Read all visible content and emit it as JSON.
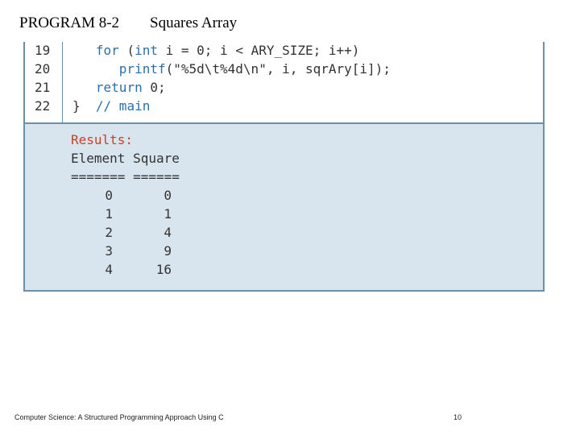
{
  "title": {
    "program": "PROGRAM 8-2",
    "name": "Squares Array"
  },
  "code_lines": [
    {
      "number": "19",
      "parts": [
        {
          "t": "   ",
          "k": "tx"
        },
        {
          "t": "for",
          "k": "kw"
        },
        {
          "t": " (",
          "k": "tx"
        },
        {
          "t": "int",
          "k": "kw"
        },
        {
          "t": " i = 0; i < ARY_SIZE; i++)",
          "k": "tx"
        }
      ]
    },
    {
      "number": "20",
      "parts": [
        {
          "t": "      ",
          "k": "tx"
        },
        {
          "t": "printf",
          "k": "kw"
        },
        {
          "t": "(\"%5d\\t%4d\\n\", i, sqrAry[i]);",
          "k": "tx"
        }
      ]
    },
    {
      "number": "21",
      "parts": [
        {
          "t": "   ",
          "k": "tx"
        },
        {
          "t": "return",
          "k": "kw"
        },
        {
          "t": " 0;",
          "k": "tx"
        }
      ]
    },
    {
      "number": "22",
      "parts": [
        {
          "t": "}  ",
          "k": "tx"
        },
        {
          "t": "// main",
          "k": "kw"
        }
      ]
    }
  ],
  "results": {
    "heading": "Results:",
    "columns": "Element Square",
    "separator": "======= ======",
    "rows": [
      {
        "element": "0",
        "square": "0"
      },
      {
        "element": "1",
        "square": "1"
      },
      {
        "element": "2",
        "square": "4"
      },
      {
        "element": "3",
        "square": "9"
      },
      {
        "element": "4",
        "square": "16"
      }
    ]
  },
  "footer": {
    "left": "Computer Science: A Structured Programming Approach Using C",
    "page": "10"
  },
  "colors": {
    "keyword": "#2e6fa8",
    "results_heading": "#c4402f",
    "results_background": "#d8e5ee",
    "border": "#6f8fa8"
  }
}
